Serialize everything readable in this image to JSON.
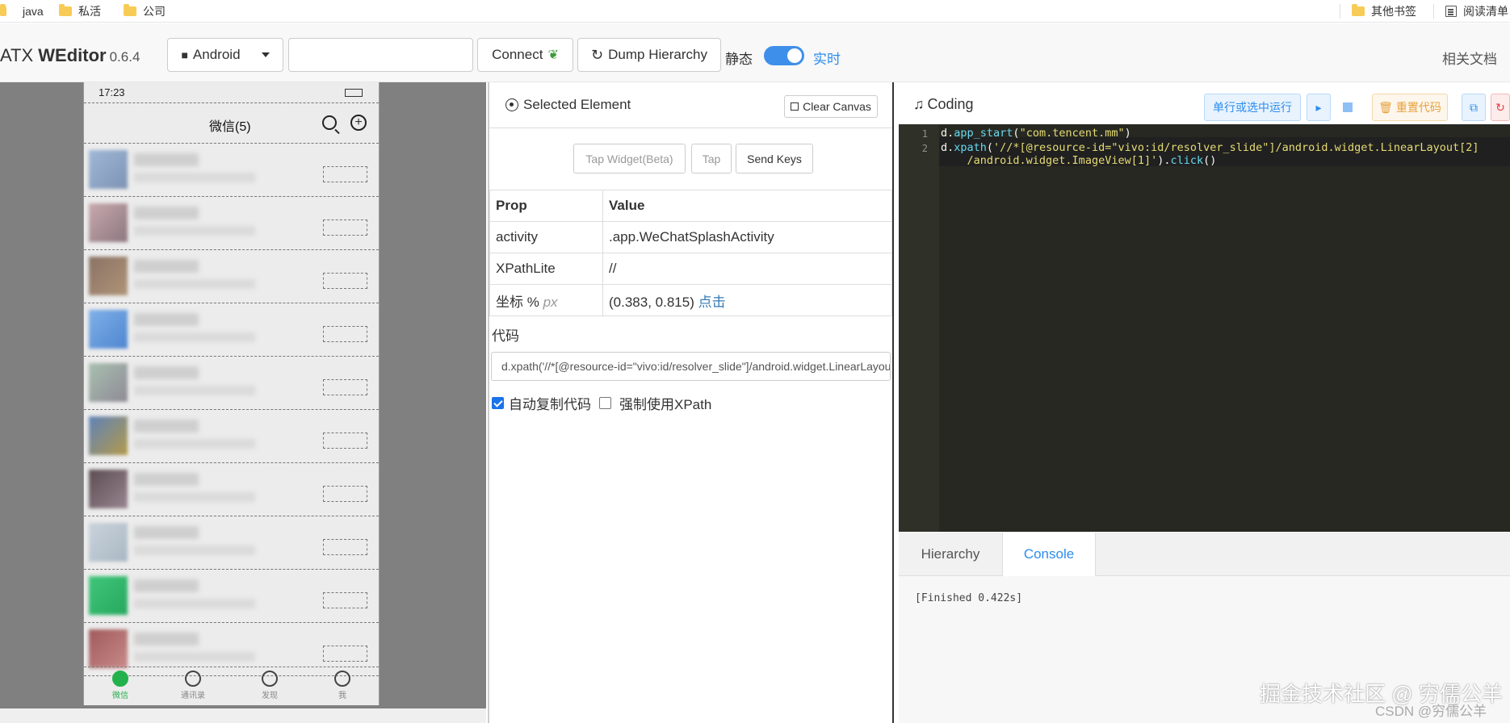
{
  "bookmarks": {
    "items": [
      {
        "label": "java"
      },
      {
        "label": "私活"
      },
      {
        "label": "公司"
      }
    ],
    "other": "其他书签",
    "reading": "阅读清单"
  },
  "navbar": {
    "brand_prefix": "ATX ",
    "brand_bold": "WEditor",
    "version": "0.6.4",
    "platform": "Android",
    "device_input_value": "",
    "connect_label": "Connect",
    "dump_label": "Dump Hierarchy",
    "static_label": "静态",
    "realtime_label": "实时",
    "docs_label": "相关文档"
  },
  "phone": {
    "status_time": "17:23",
    "title": "微信(5)",
    "tabs": [
      "微信",
      "通讯录",
      "发现",
      "我"
    ]
  },
  "selected": {
    "title": "Selected Element",
    "clear_canvas": "Clear Canvas",
    "buttons": [
      "Tap Widget(Beta)",
      "Tap",
      "Send Keys"
    ],
    "table_headers": [
      "Prop",
      "Value"
    ],
    "rows": [
      {
        "prop": "activity",
        "value": ".app.WeChatSplashActivity"
      },
      {
        "prop": "XPathLite",
        "value": "//"
      }
    ],
    "coord_prop": "坐标 %",
    "coord_unit": "px",
    "coord_value": "(0.383, 0.815)",
    "coord_link": "点击",
    "code_label": "代码",
    "code_value": "d.xpath('//*[@resource-id=\"vivo:id/resolver_slide\"]/android.widget.LinearLayout[2]/android.widget.ImageView[1]').click()",
    "auto_copy": "自动复制代码",
    "force_xpath": "强制使用XPath"
  },
  "coding": {
    "title": "Coding",
    "run_label": "单行或选中运行",
    "reset_label": "重置代码",
    "lines": [
      {
        "num": "1"
      },
      {
        "num": "2"
      }
    ],
    "tabs": [
      "Hierarchy",
      "Console"
    ],
    "console_output": "[Finished 0.422s]"
  },
  "watermark": "掘金技术社区 @ 穷儒公羊",
  "watermark2": "CSDN @穷儒公羊",
  "colors": {
    "accent": "#2d8cf0",
    "toggle": "#3e8fea",
    "editor_bg": "#272822"
  }
}
